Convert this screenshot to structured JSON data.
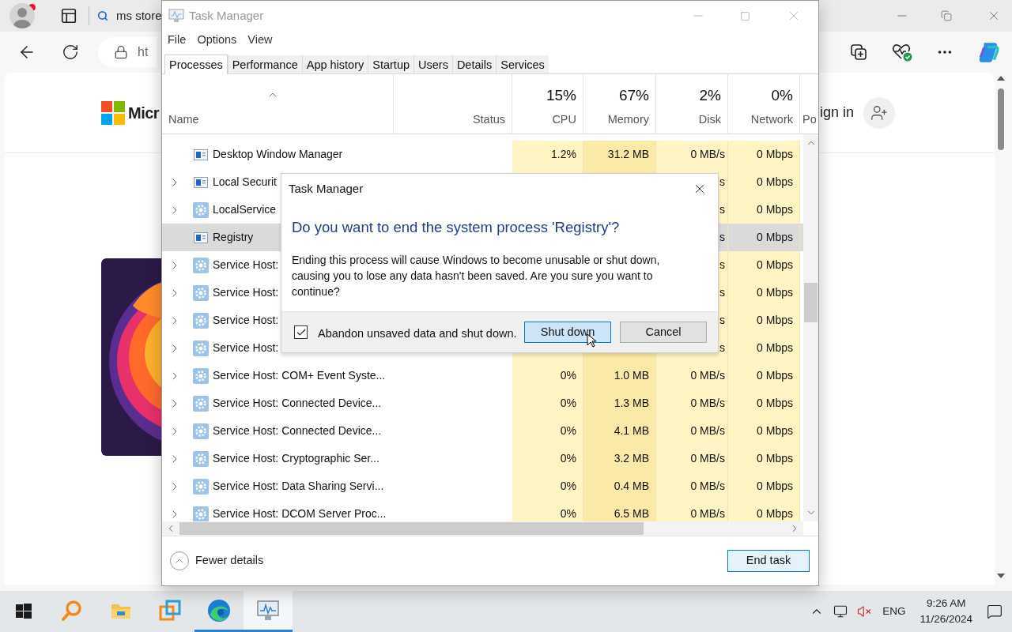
{
  "browser": {
    "tab_title": "ms store",
    "address": "ht",
    "brand": "Micr",
    "sign_in": "ign in"
  },
  "task_manager": {
    "title": "Task Manager",
    "menu": [
      "File",
      "Options",
      "View"
    ],
    "tabs": [
      {
        "label": "Processes",
        "selected": true
      },
      {
        "label": "Performance",
        "selected": false
      },
      {
        "label": "App history",
        "selected": false
      },
      {
        "label": "Startup",
        "selected": false
      },
      {
        "label": "Users",
        "selected": false
      },
      {
        "label": "Details",
        "selected": false
      },
      {
        "label": "Services",
        "selected": false
      }
    ],
    "columns": [
      {
        "label": "Name"
      },
      {
        "label": "Status"
      },
      {
        "percent": "15%",
        "label": "CPU"
      },
      {
        "percent": "67%",
        "label": "Memory"
      },
      {
        "percent": "2%",
        "label": "Disk"
      },
      {
        "percent": "0%",
        "label": "Network"
      },
      {
        "label": "Po"
      }
    ],
    "rows": [
      {
        "kind": "app",
        "expandable": false,
        "selected": false,
        "name": "Desktop Window Manager",
        "cpu": "1.2%",
        "memory": "31.2 MB",
        "disk": "0 MB/s",
        "network": "0 Mbps"
      },
      {
        "kind": "app",
        "expandable": true,
        "selected": false,
        "name": "Local Securit",
        "disk": "s",
        "network": "0 Mbps"
      },
      {
        "kind": "service",
        "expandable": true,
        "selected": false,
        "name": "LocalService",
        "disk": "s",
        "network": "0 Mbps"
      },
      {
        "kind": "app",
        "expandable": false,
        "selected": true,
        "name": "Registry",
        "disk": "s",
        "network": "0 Mbps"
      },
      {
        "kind": "service",
        "expandable": true,
        "selected": false,
        "name": "Service Host:",
        "disk": "s",
        "network": "0 Mbps"
      },
      {
        "kind": "service",
        "expandable": true,
        "selected": false,
        "name": "Service Host:",
        "disk": "s",
        "network": "0 Mbps"
      },
      {
        "kind": "service",
        "expandable": true,
        "selected": false,
        "name": "Service Host:",
        "disk": "s",
        "network": "0 Mbps"
      },
      {
        "kind": "service",
        "expandable": true,
        "selected": false,
        "name": "Service Host:",
        "disk": "s",
        "network": "0 Mbps"
      },
      {
        "kind": "service",
        "expandable": true,
        "selected": false,
        "name": "Service Host: COM+ Event Syste...",
        "cpu": "0%",
        "memory": "1.0 MB",
        "disk": "0 MB/s",
        "network": "0 Mbps"
      },
      {
        "kind": "service",
        "expandable": true,
        "selected": false,
        "name": "Service Host: Connected Device...",
        "cpu": "0%",
        "memory": "1.3 MB",
        "disk": "0 MB/s",
        "network": "0 Mbps"
      },
      {
        "kind": "service",
        "expandable": true,
        "selected": false,
        "name": "Service Host: Connected Device...",
        "cpu": "0%",
        "memory": "4.1 MB",
        "disk": "0 MB/s",
        "network": "0 Mbps"
      },
      {
        "kind": "service",
        "expandable": true,
        "selected": false,
        "name": "Service Host: Cryptographic Ser...",
        "cpu": "0%",
        "memory": "3.2 MB",
        "disk": "0 MB/s",
        "network": "0 Mbps"
      },
      {
        "kind": "service",
        "expandable": true,
        "selected": false,
        "name": "Service Host: Data Sharing Servi...",
        "cpu": "0%",
        "memory": "0.4 MB",
        "disk": "0 MB/s",
        "network": "0 Mbps"
      },
      {
        "kind": "service",
        "expandable": true,
        "selected": false,
        "name": "Service Host: DCOM Server Proc...",
        "cpu": "0%",
        "memory": "6.5 MB",
        "disk": "0 MB/s",
        "network": "0 Mbps"
      }
    ],
    "fewer_details": "Fewer details",
    "end_task": "End task"
  },
  "dialog": {
    "title": "Task Manager",
    "heading": "Do you want to end the system process 'Registry'?",
    "body": "Ending this process will cause Windows to become unusable or shut down, causing you to lose any data hasn't been saved. Are you sure you want to continue?",
    "checkbox": {
      "label": "Abandon unsaved data and shut down.",
      "checked": true
    },
    "buttons": [
      {
        "label": "Shut down",
        "kind": "default"
      },
      {
        "label": "Cancel",
        "kind": "normal"
      }
    ]
  },
  "taskbar": {
    "apps": [
      {
        "kind": "search",
        "active": false,
        "selected": false
      },
      {
        "kind": "files",
        "active": false,
        "selected": false
      },
      {
        "kind": "vm",
        "active": false,
        "selected": false
      },
      {
        "kind": "edge",
        "active": true,
        "selected": false
      },
      {
        "kind": "task-manager",
        "active": true,
        "selected": true
      }
    ],
    "language": "ENG",
    "time": "9:26 AM",
    "date": "11/26/2024"
  }
}
